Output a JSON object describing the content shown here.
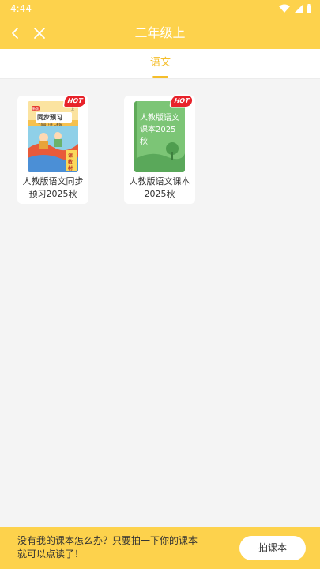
{
  "status_bar": {
    "time": "4:44",
    "icons": [
      "wifi-icon",
      "signal-icon",
      "battery-icon"
    ]
  },
  "header": {
    "title": "二年级上",
    "back_icon": "chevron-left-icon",
    "close_icon": "close-icon"
  },
  "tabs": [
    {
      "label": "语文",
      "active": true
    }
  ],
  "books": [
    {
      "title_line1": "人教版语文同步",
      "title_line2": "预习2025秋",
      "badge": "HOT",
      "cover": {
        "heading": "同步预习",
        "sub": "二年级 上册 人教版",
        "corner": "上",
        "tag": "新版",
        "side1": "课",
        "side2": "教",
        "side3": "材"
      }
    },
    {
      "title_line1": "人教版语文课本",
      "title_line2": "2025秋",
      "badge": "HOT",
      "cover": {
        "text": "人教版语文课本2025秋"
      }
    }
  ],
  "bottom": {
    "prompt_line1": "没有我的课本怎么办？只要拍一下你的课本",
    "prompt_line2": "就可以点读了！",
    "button_label": "拍课本"
  },
  "colors": {
    "primary": "#fdd24c",
    "accent": "#f5be2b",
    "hot": "#e8222a",
    "background": "#f4f4f4"
  }
}
